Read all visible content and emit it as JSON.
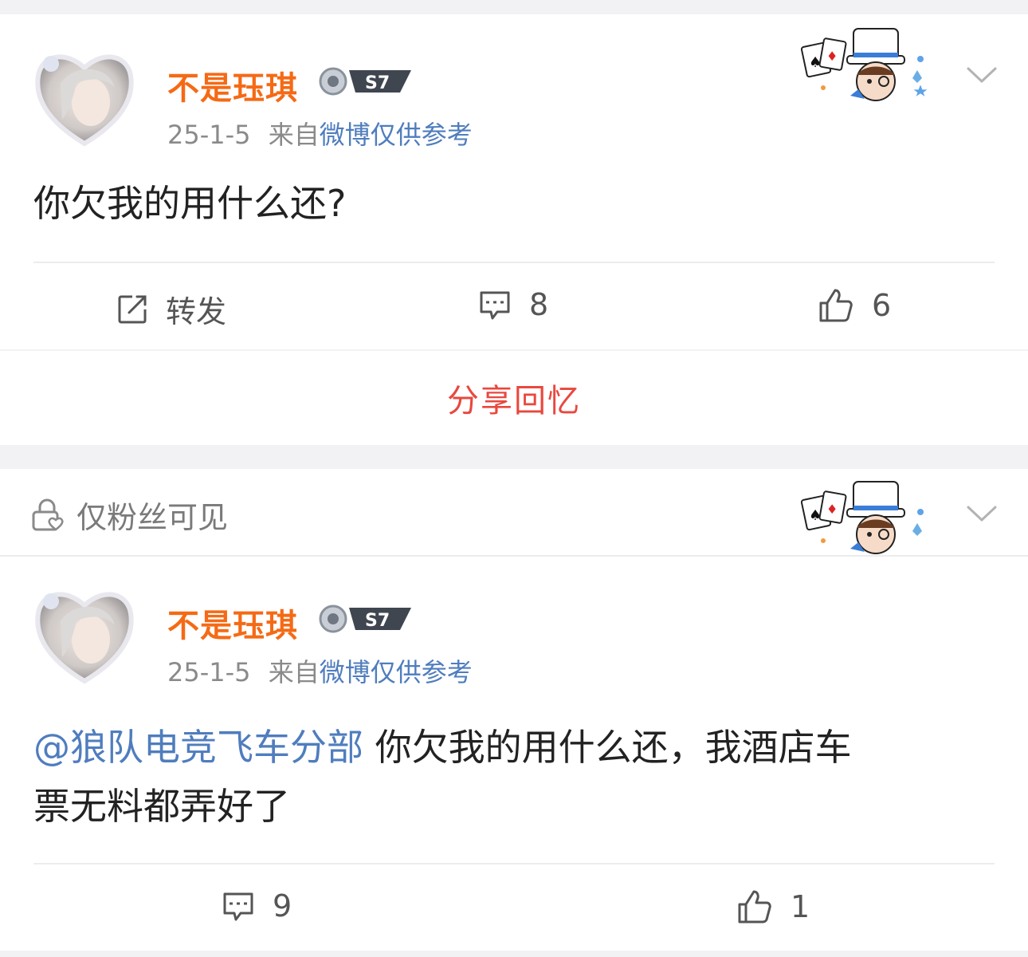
{
  "posts": [
    {
      "username": "不是珏琪",
      "vip_level": "S7",
      "date": "25-1-5",
      "source_prefix": "来自",
      "source": "微博仅供参考",
      "mention": "",
      "text": "你欠我的用什么还?",
      "actions": {
        "repost_label": "转发",
        "comments": "8",
        "likes": "6"
      }
    },
    {
      "visibility_label": "仅粉丝可见",
      "username": "不是珏琪",
      "vip_level": "S7",
      "date": "25-1-5",
      "source_prefix": "来自",
      "source": "微博仅供参考",
      "mention": "@狼队电竞飞车分部",
      "text_line1": " 你欠我的用什么还，我酒店车",
      "text_line2": "票无料都弄好了",
      "actions": {
        "comments": "9",
        "likes": "1"
      }
    }
  ],
  "share_memory_label": "分享回忆",
  "colors": {
    "username": "#f56a15",
    "link": "#4f7dbe",
    "share": "#e8483f",
    "background": "#f2f2f5"
  },
  "icons": [
    "repost-icon",
    "comment-icon",
    "like-icon",
    "chevron-down-icon",
    "lock-heart-icon",
    "vip-badge-icon",
    "sticker-icon"
  ]
}
